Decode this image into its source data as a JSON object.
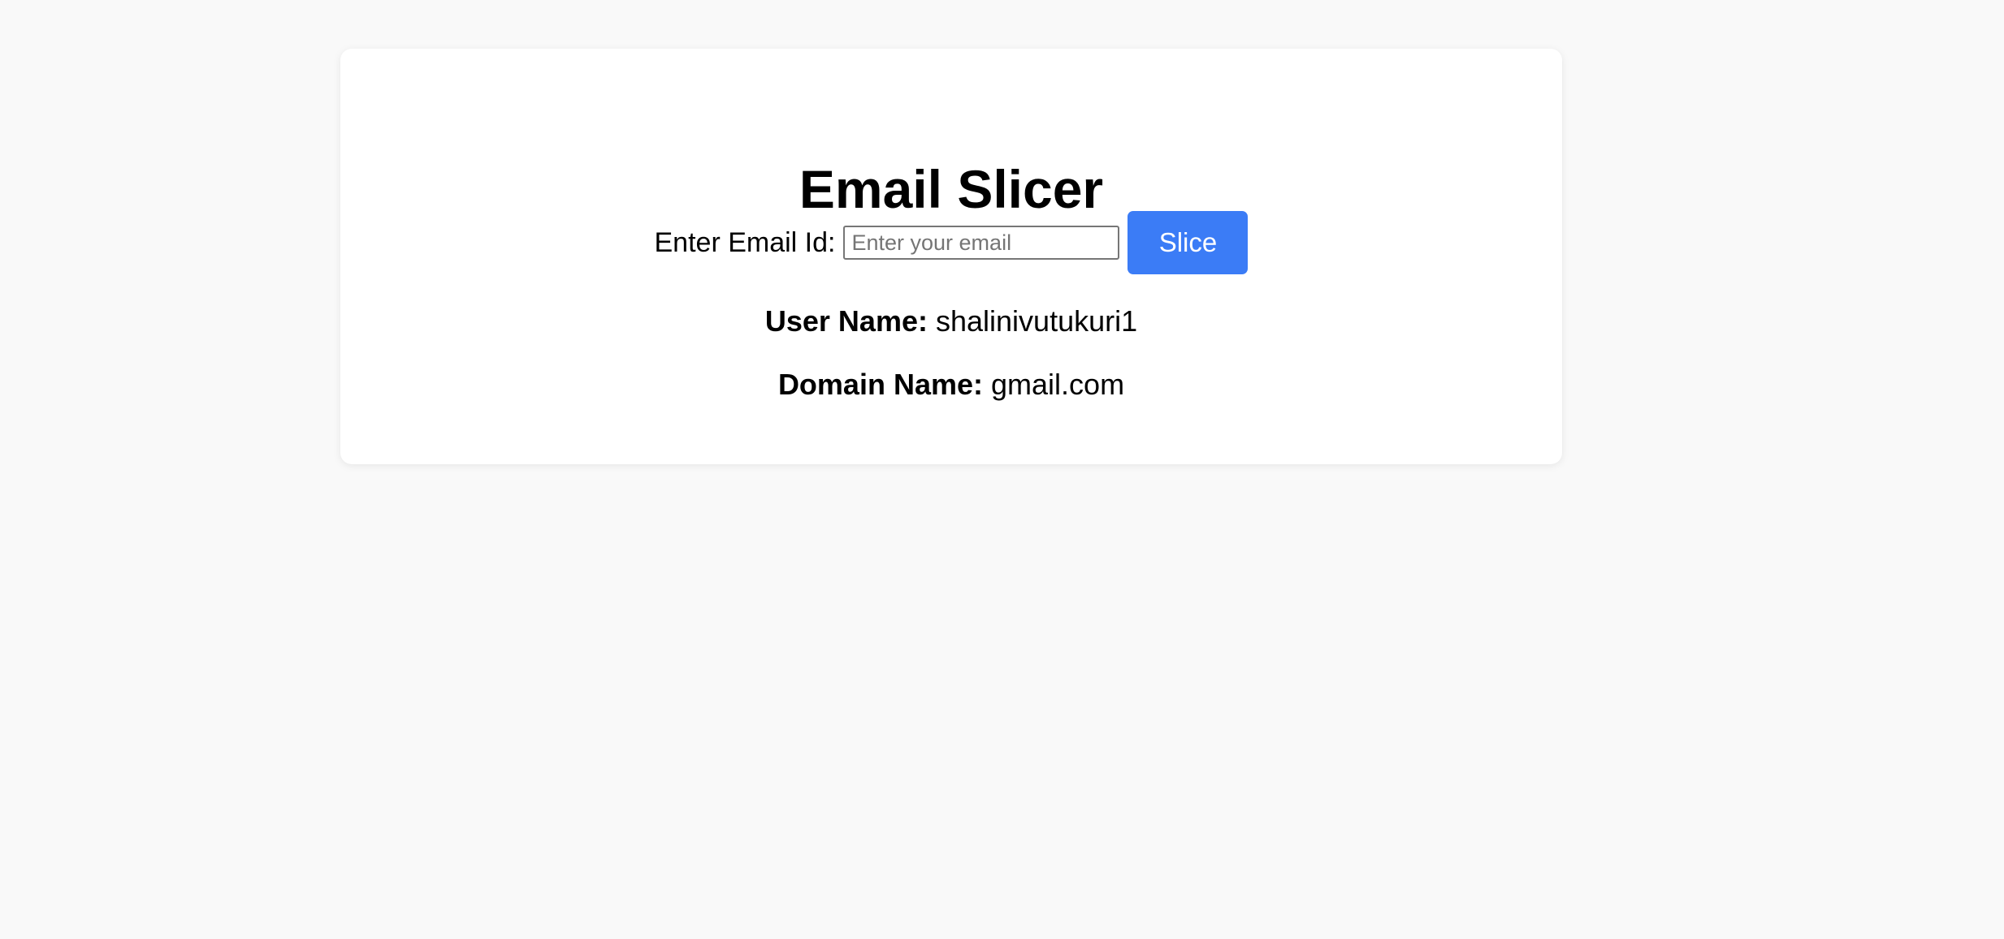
{
  "app": {
    "title": "Email Slicer"
  },
  "form": {
    "label": "Enter Email Id:",
    "input_value": "",
    "input_placeholder": "Enter your email",
    "button_label": "Slice"
  },
  "results": {
    "user_label": "User Name:",
    "user_value": "shalinivutukuri1",
    "domain_label": "Domain Name:",
    "domain_value": "gmail.com"
  },
  "colors": {
    "background": "#f9f9f9",
    "card": "#ffffff",
    "button": "#3b7cf6",
    "button_text": "#ffffff",
    "text": "#000000"
  }
}
